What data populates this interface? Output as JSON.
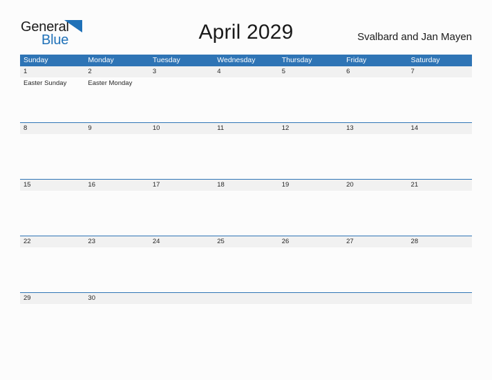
{
  "brand": {
    "word_one": "General",
    "word_two": "Blue",
    "flag_icon": "blue-flag-triangle",
    "accent_color": "#1F71B8"
  },
  "header": {
    "month_title": "April 2029",
    "locale": "Svalbard and Jan Mayen"
  },
  "colors": {
    "header_blue": "#2E74B5",
    "date_band_gray": "#F1F1F1",
    "page_background": "#FCFCFC",
    "text_dark": "#262626"
  },
  "calendar": {
    "weekdays": [
      "Sunday",
      "Monday",
      "Tuesday",
      "Wednesday",
      "Thursday",
      "Friday",
      "Saturday"
    ],
    "weeks": [
      {
        "days": [
          {
            "date": "1",
            "events": [
              "Easter Sunday"
            ]
          },
          {
            "date": "2",
            "events": [
              "Easter Monday"
            ]
          },
          {
            "date": "3",
            "events": []
          },
          {
            "date": "4",
            "events": []
          },
          {
            "date": "5",
            "events": []
          },
          {
            "date": "6",
            "events": []
          },
          {
            "date": "7",
            "events": []
          }
        ]
      },
      {
        "days": [
          {
            "date": "8",
            "events": []
          },
          {
            "date": "9",
            "events": []
          },
          {
            "date": "10",
            "events": []
          },
          {
            "date": "11",
            "events": []
          },
          {
            "date": "12",
            "events": []
          },
          {
            "date": "13",
            "events": []
          },
          {
            "date": "14",
            "events": []
          }
        ]
      },
      {
        "days": [
          {
            "date": "15",
            "events": []
          },
          {
            "date": "16",
            "events": []
          },
          {
            "date": "17",
            "events": []
          },
          {
            "date": "18",
            "events": []
          },
          {
            "date": "19",
            "events": []
          },
          {
            "date": "20",
            "events": []
          },
          {
            "date": "21",
            "events": []
          }
        ]
      },
      {
        "days": [
          {
            "date": "22",
            "events": []
          },
          {
            "date": "23",
            "events": []
          },
          {
            "date": "24",
            "events": []
          },
          {
            "date": "25",
            "events": []
          },
          {
            "date": "26",
            "events": []
          },
          {
            "date": "27",
            "events": []
          },
          {
            "date": "28",
            "events": []
          }
        ]
      },
      {
        "days": [
          {
            "date": "29",
            "events": []
          },
          {
            "date": "30",
            "events": []
          },
          {
            "date": "",
            "events": []
          },
          {
            "date": "",
            "events": []
          },
          {
            "date": "",
            "events": []
          },
          {
            "date": "",
            "events": []
          },
          {
            "date": "",
            "events": []
          }
        ]
      }
    ]
  }
}
